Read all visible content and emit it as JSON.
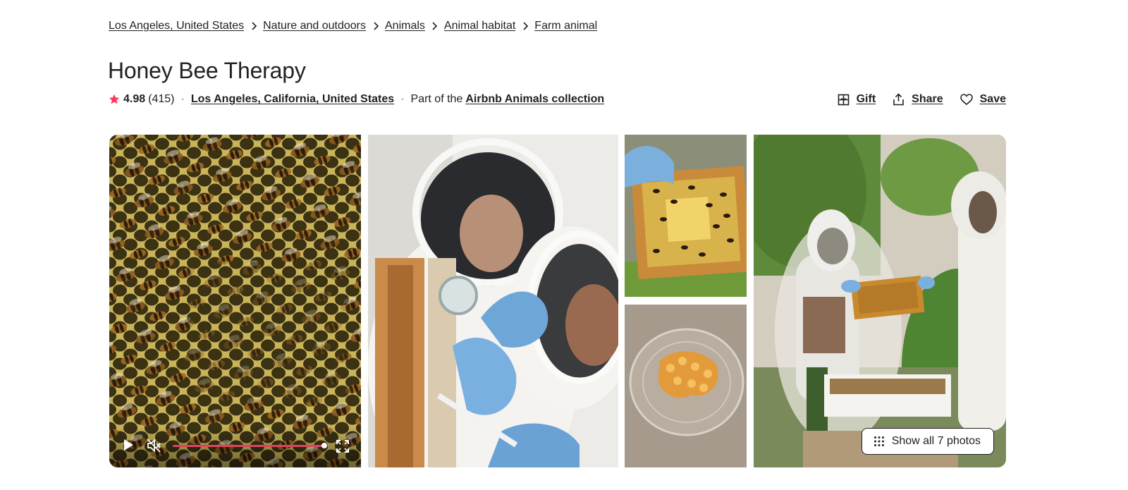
{
  "breadcrumb": [
    {
      "label": "Los Angeles, United States"
    },
    {
      "label": "Nature and outdoors"
    },
    {
      "label": "Animals"
    },
    {
      "label": "Animal habitat"
    },
    {
      "label": "Farm animal"
    }
  ],
  "title": "Honey Bee Therapy",
  "rating": {
    "value": "4.98",
    "reviews": "(415)",
    "star_color": "#ff385c"
  },
  "location": "Los Angeles, California, United States",
  "collection": {
    "prefix": "Part of the",
    "link": "Airbnb Animals collection"
  },
  "actions": {
    "gift": "Gift",
    "share": "Share",
    "save": "Save"
  },
  "gallery": {
    "show_all": "Show all 7 photos",
    "video": {
      "playing": false,
      "muted": true,
      "progress": 0.98
    }
  },
  "colors": {
    "text": "#222222",
    "accent": "#e0435d",
    "border": "#222222"
  },
  "icons": [
    "chevron-right-icon",
    "star-icon",
    "gift-icon",
    "share-icon",
    "heart-icon",
    "play-icon",
    "mute-icon",
    "fullscreen-icon",
    "grid-icon"
  ]
}
